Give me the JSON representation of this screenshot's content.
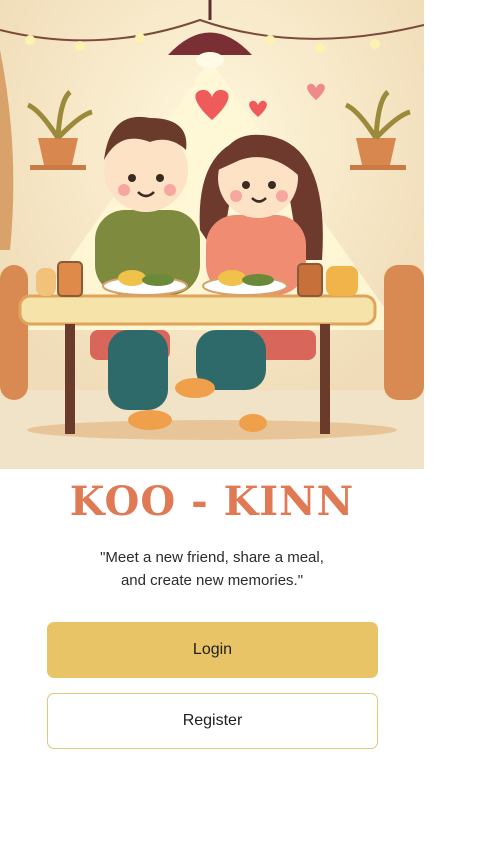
{
  "hero": {
    "illustration_icon": "couple-dining-illustration"
  },
  "app": {
    "title": "KOO - KINN",
    "tagline_line1": "\"Meet a new friend, share a meal,",
    "tagline_line2": "and create new memories.\""
  },
  "actions": {
    "login_label": "Login",
    "register_label": "Register"
  },
  "colors": {
    "brand": "#e07a55",
    "primary_button": "#e9c467",
    "secondary_border": "#e2c77a"
  }
}
